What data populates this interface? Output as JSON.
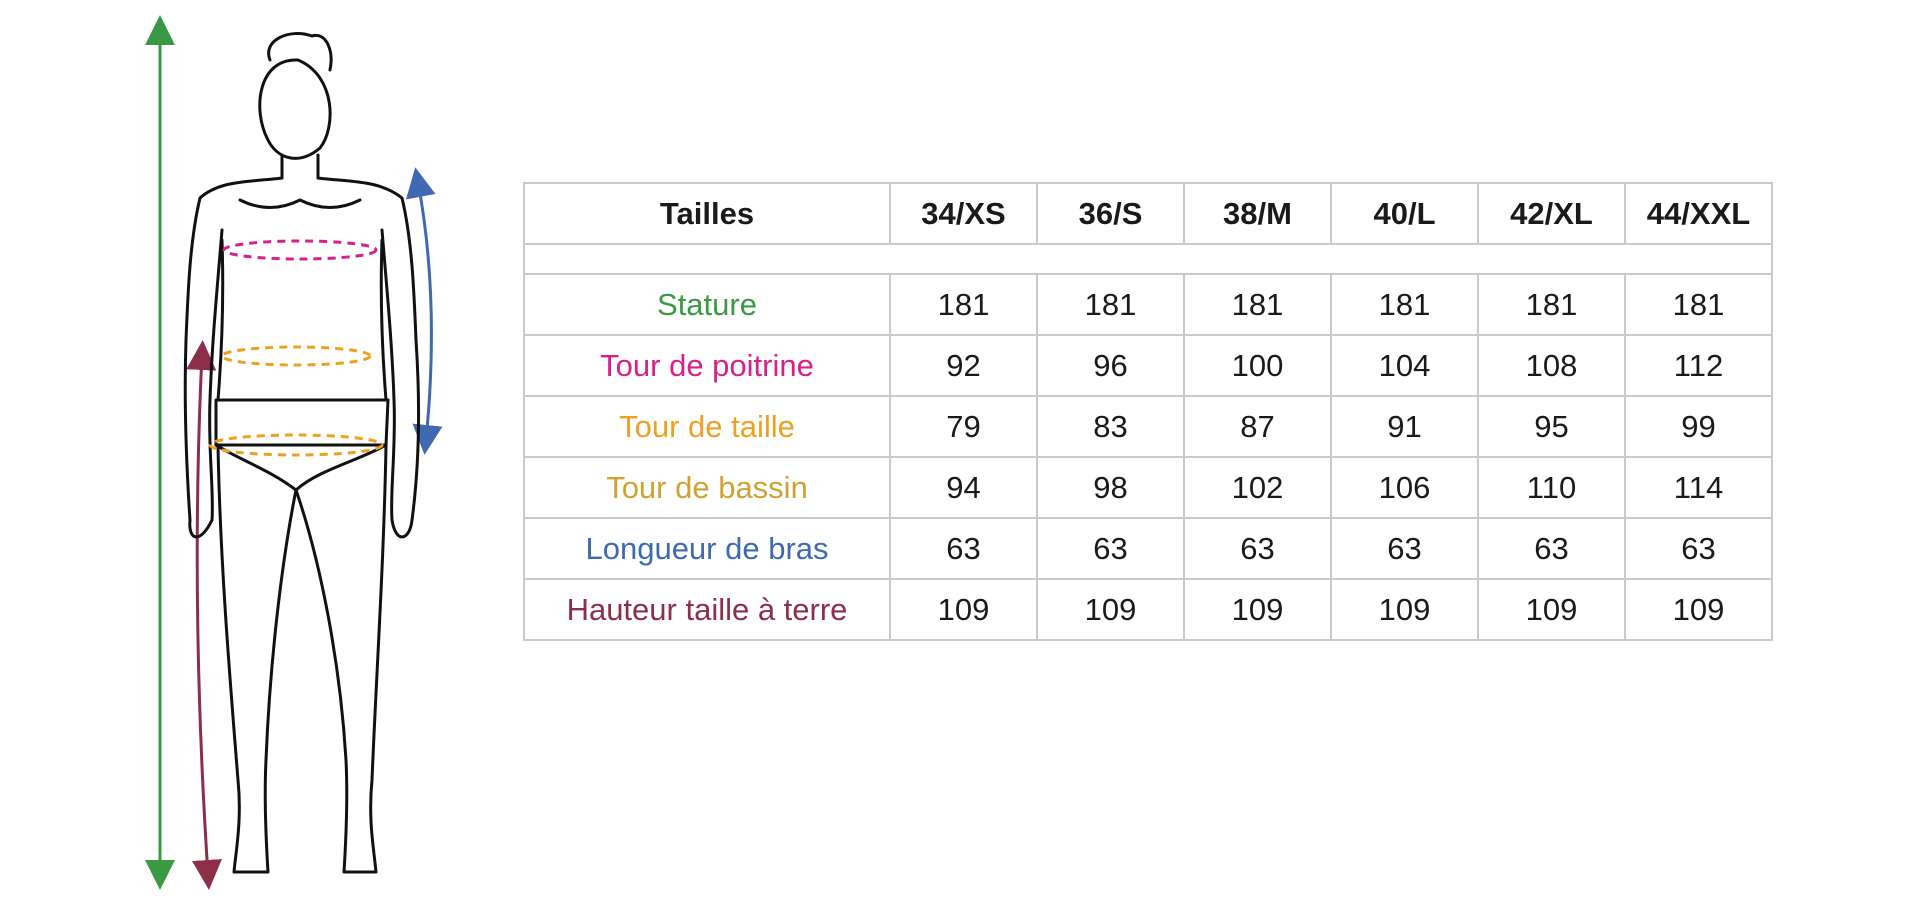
{
  "table": {
    "corner_label": "Tailles",
    "sizes": [
      "34/XS",
      "36/S",
      "38/M",
      "40/L",
      "42/XL",
      "44/XXL"
    ],
    "rows": [
      {
        "label": "Stature",
        "color": "#3a9a44",
        "values": [
          "181",
          "181",
          "181",
          "181",
          "181",
          "181"
        ]
      },
      {
        "label": "Tour de poitrine",
        "color": "#d9208a",
        "values": [
          "92",
          "96",
          "100",
          "104",
          "108",
          "112"
        ]
      },
      {
        "label": "Tour de taille",
        "color": "#f0a020",
        "values": [
          "79",
          "83",
          "87",
          "91",
          "95",
          "99"
        ]
      },
      {
        "label": "Tour de bassin",
        "color": "#cfa332",
        "values": [
          "94",
          "98",
          "102",
          "106",
          "110",
          "114"
        ]
      },
      {
        "label": "Longueur de bras",
        "color": "#3f69b0",
        "values": [
          "63",
          "63",
          "63",
          "63",
          "63",
          "63"
        ]
      },
      {
        "label": "Hauteur taille à terre",
        "color": "#8e2f4a",
        "values": [
          "109",
          "109",
          "109",
          "109",
          "109",
          "109"
        ]
      }
    ]
  },
  "figure": {
    "icon": "body-measurement-illustration",
    "colors": {
      "stature": "#3a9a44",
      "chest": "#d9208a",
      "waist": "#f0a020",
      "hip": "#cfa332",
      "arm": "#3f69b0",
      "inseam": "#8e2f4a"
    }
  }
}
